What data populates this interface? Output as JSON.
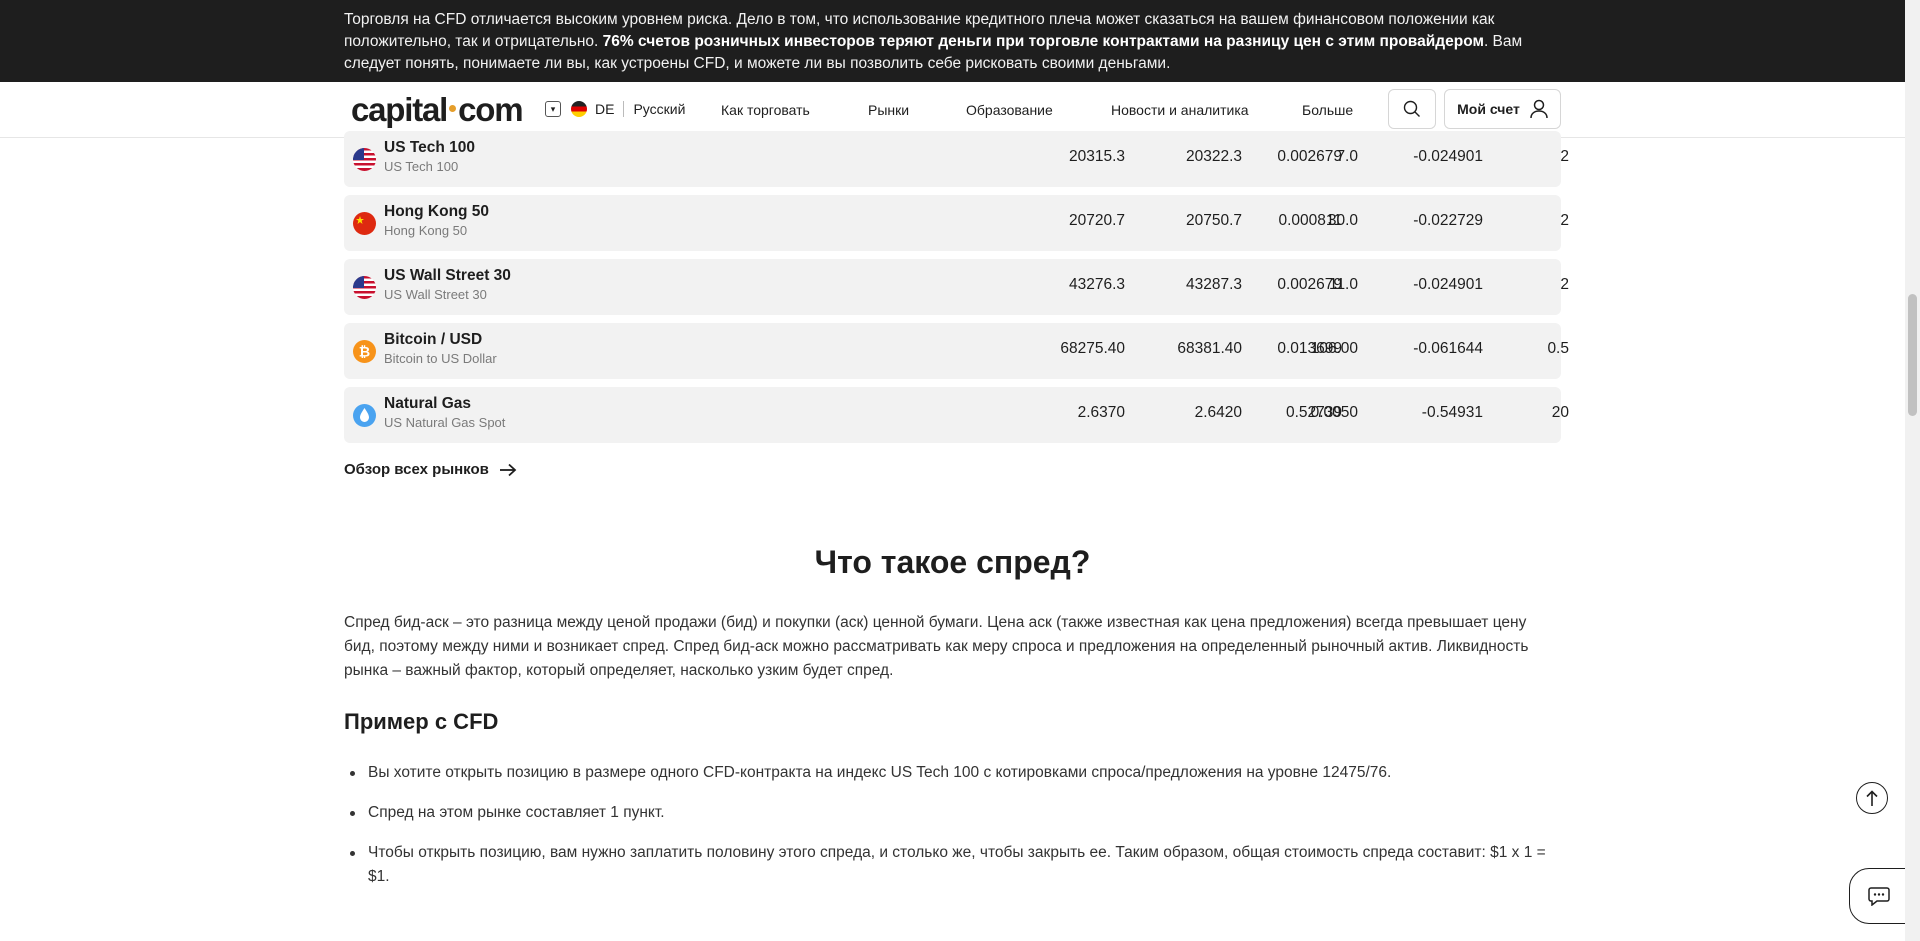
{
  "risk_banner": {
    "text_before": "Торговля на CFD отличается высоким уровнем риска. Дело в том, что использование кредитного плеча может сказаться на вашем финансовом положении как положительно, так и отрицательно. ",
    "text_bold": "76% счетов розничных инвесторов теряют деньги при торговле контрактами на разницу цен с этим провайдером",
    "text_after": ". Вам следует понять, понимаете ли вы, как устроены CFD, и можете ли вы позволить себе рисковать своими деньгами."
  },
  "header": {
    "logo": "capital",
    "logo_suffix": "com",
    "country": "DE",
    "language": "Русский",
    "menu": [
      "Как торговать",
      "Рынки",
      "Образование",
      "Новости и аналитика",
      "Больше"
    ],
    "account_label": "Мой счет"
  },
  "markets": [
    {
      "name": "US Tech 100",
      "sub": "US Tech 100",
      "sell": "20315.3",
      "buy": "20322.3",
      "spread": "7.0",
      "overnight_long": "-0.024901",
      "overnight_short": "0.002679",
      "margin": "2",
      "icon": "us-flag-icon"
    },
    {
      "name": "Hong Kong 50",
      "sub": "Hong Kong 50",
      "sell": "20720.7",
      "buy": "20750.7",
      "spread": "30.0",
      "overnight_long": "-0.022729",
      "overnight_short": "0.000811",
      "margin": "2",
      "icon": "china-flag-icon"
    },
    {
      "name": "US Wall Street 30",
      "sub": "US Wall Street 30",
      "sell": "43276.3",
      "buy": "43287.3",
      "spread": "11.0",
      "overnight_long": "-0.024901",
      "overnight_short": "0.002679",
      "margin": "2",
      "icon": "us-flag-icon"
    },
    {
      "name": "Bitcoin / USD",
      "sub": "Bitcoin to US Dollar",
      "sell": "68275.40",
      "buy": "68381.40",
      "spread": "106.00",
      "overnight_long": "-0.061644",
      "overnight_short": "0.013699",
      "margin": "0.5",
      "icon": "bitcoin-icon"
    },
    {
      "name": "Natural Gas",
      "sub": "US Natural Gas Spot",
      "sell": "2.6370",
      "buy": "2.6420",
      "spread": "0.0050",
      "overnight_long": "-0.54931",
      "overnight_short": "0.52739",
      "margin": "20",
      "icon": "gas-drop-icon"
    }
  ],
  "all_markets_link": "Обзор всех рынков",
  "section": {
    "title": "Что такое спред?",
    "paragraph": "Спред бид-аск – это разница между ценой продажи (бид) и покупки (аск) ценной бумаги. Цена аск (также известная как цена предложения) всегда превышает цену бид, поэтому между ними и возникает спред. Спред бид-аск можно рассматривать как меру спроса и предложения на определенный рыночный актив. Ликвидность рынка – важный фактор, который определяет, насколько узким будет спред.",
    "example_title": "Пример с CFD",
    "bullets": [
      "Вы хотите открыть позицию в размере одного CFD-контракта на индекс US Tech 100 с котировками спроса/предложения на уровне 12475/76.",
      "Спред на этом рынке составляет 1 пункт.",
      "Чтобы открыть позицию, вам нужно заплатить половину этого спреда, и столько же, чтобы закрыть ее. Таким образом, общая стоимость спреда составит: $1 х 1 = $1."
    ]
  },
  "colors": {
    "banner": "#1e1e1e",
    "row_bg": "#f2f2f2",
    "logo_dot": "#e59e2a",
    "bitcoin": "#f7931a",
    "gas": "#4aa3f0"
  }
}
